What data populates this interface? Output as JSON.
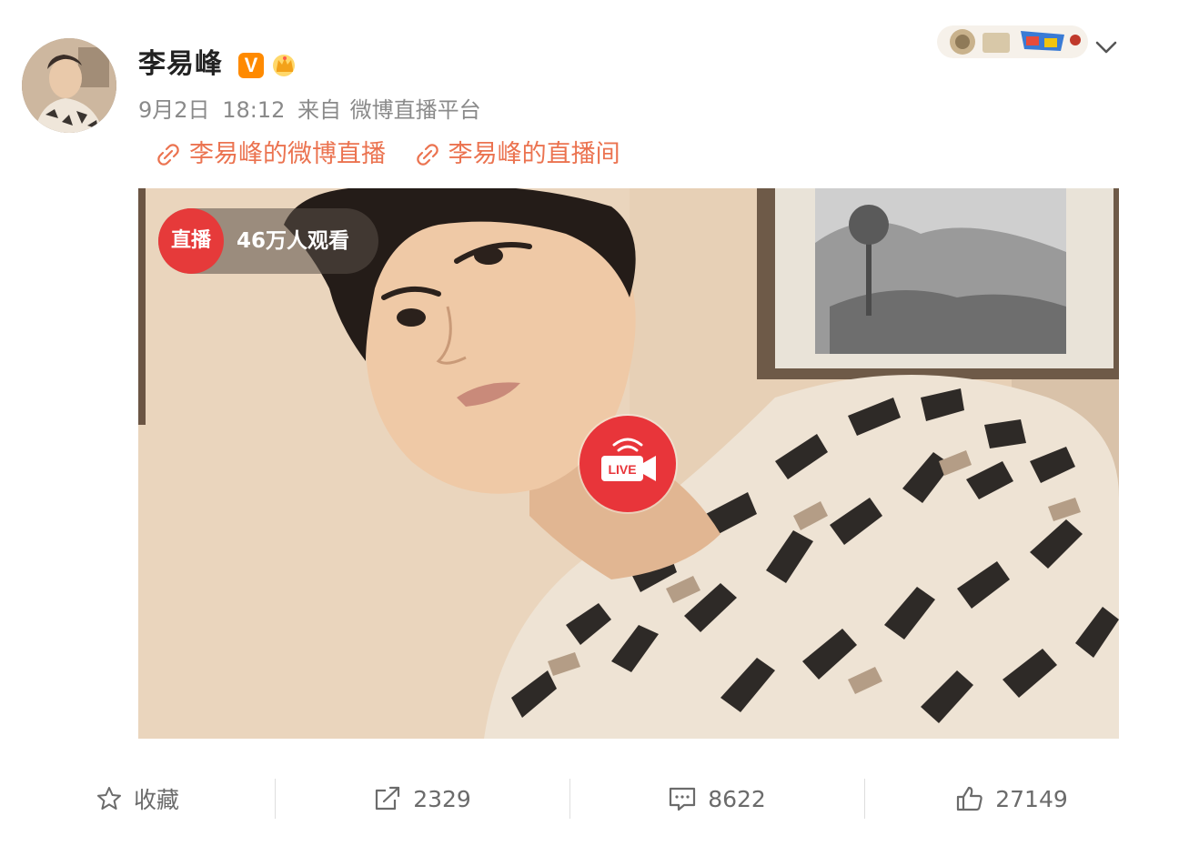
{
  "post": {
    "author": "李易峰",
    "verified_badge": "V",
    "date": "9月2日",
    "time": "18:12",
    "source_prefix": "来自",
    "source": "微博直播平台"
  },
  "links": [
    {
      "label": "李易峰的微博直播",
      "icon": "link-icon"
    },
    {
      "label": "李易峰的直播间",
      "icon": "link-icon"
    }
  ],
  "live": {
    "badge_label": "直播",
    "viewers": "46万人观看",
    "button_label": "LIVE"
  },
  "actions": {
    "favorite": {
      "label": "收藏",
      "icon": "star-icon"
    },
    "repost": {
      "count": "2329",
      "icon": "repost-icon"
    },
    "comment": {
      "count": "8622",
      "icon": "comment-icon"
    },
    "like": {
      "count": "27149",
      "icon": "thumbs-up-icon"
    }
  },
  "colors": {
    "link": "#eb7350",
    "live_red": "#e63a3a",
    "verified_orange": "#ff8a00",
    "meta_gray": "#8a8a8a"
  }
}
